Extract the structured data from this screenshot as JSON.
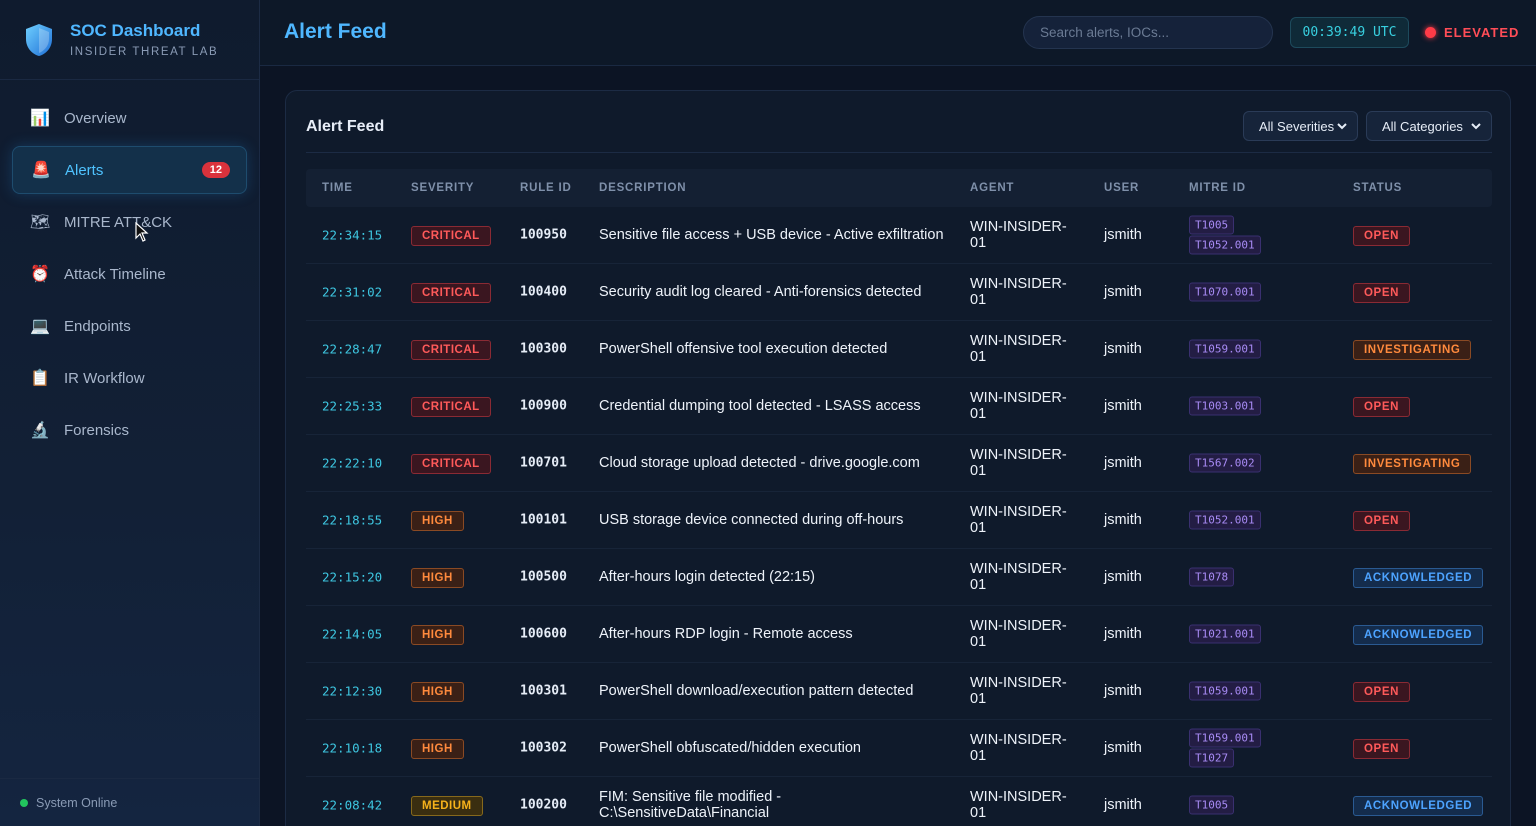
{
  "brand": {
    "title": "SOC Dashboard",
    "subtitle": "INSIDER THREAT LAB"
  },
  "nav": [
    {
      "label": "Overview",
      "icon": "bar-chart-icon",
      "glyph": "📊",
      "active": false
    },
    {
      "label": "Alerts",
      "icon": "siren-icon",
      "glyph": "🚨",
      "active": true,
      "badge": "12"
    },
    {
      "label": "MITRE ATT&CK",
      "icon": "map-icon",
      "glyph": "🗺",
      "active": false
    },
    {
      "label": "Attack Timeline",
      "icon": "clock-icon",
      "glyph": "⏰",
      "active": false
    },
    {
      "label": "Endpoints",
      "icon": "laptop-icon",
      "glyph": "💻",
      "active": false
    },
    {
      "label": "IR Workflow",
      "icon": "clipboard-icon",
      "glyph": "📋",
      "active": false
    },
    {
      "label": "Forensics",
      "icon": "microscope-icon",
      "glyph": "🔬",
      "active": false
    }
  ],
  "system_status": "System Online",
  "header": {
    "title": "Alert Feed",
    "search_placeholder": "Search alerts, IOCs...",
    "clock": "00:39:49 UTC",
    "threat_level": "ELEVATED"
  },
  "panel": {
    "title": "Alert Feed",
    "severity_filter": "All Severities",
    "category_filter": "All Categories"
  },
  "columns": {
    "time": "TIME",
    "severity": "SEVERITY",
    "rule": "RULE ID",
    "description": "DESCRIPTION",
    "agent": "AGENT",
    "user": "USER",
    "mitre": "MITRE ID",
    "status": "STATUS"
  },
  "alerts": [
    {
      "time": "22:34:15",
      "severity": "CRITICAL",
      "rule": "100950",
      "description": "Sensitive file access + USB device - Active exfiltration",
      "agent": "WIN-INSIDER-01",
      "user": "jsmith",
      "mitre": [
        "T1005",
        "T1052.001"
      ],
      "status": "OPEN"
    },
    {
      "time": "22:31:02",
      "severity": "CRITICAL",
      "rule": "100400",
      "description": "Security audit log cleared - Anti-forensics detected",
      "agent": "WIN-INSIDER-01",
      "user": "jsmith",
      "mitre": [
        "T1070.001"
      ],
      "status": "OPEN"
    },
    {
      "time": "22:28:47",
      "severity": "CRITICAL",
      "rule": "100300",
      "description": "PowerShell offensive tool execution detected",
      "agent": "WIN-INSIDER-01",
      "user": "jsmith",
      "mitre": [
        "T1059.001"
      ],
      "status": "INVESTIGATING"
    },
    {
      "time": "22:25:33",
      "severity": "CRITICAL",
      "rule": "100900",
      "description": "Credential dumping tool detected - LSASS access",
      "agent": "WIN-INSIDER-01",
      "user": "jsmith",
      "mitre": [
        "T1003.001"
      ],
      "status": "OPEN"
    },
    {
      "time": "22:22:10",
      "severity": "CRITICAL",
      "rule": "100701",
      "description": "Cloud storage upload detected - drive.google.com",
      "agent": "WIN-INSIDER-01",
      "user": "jsmith",
      "mitre": [
        "T1567.002"
      ],
      "status": "INVESTIGATING"
    },
    {
      "time": "22:18:55",
      "severity": "HIGH",
      "rule": "100101",
      "description": "USB storage device connected during off-hours",
      "agent": "WIN-INSIDER-01",
      "user": "jsmith",
      "mitre": [
        "T1052.001"
      ],
      "status": "OPEN"
    },
    {
      "time": "22:15:20",
      "severity": "HIGH",
      "rule": "100500",
      "description": "After-hours login detected (22:15)",
      "agent": "WIN-INSIDER-01",
      "user": "jsmith",
      "mitre": [
        "T1078"
      ],
      "status": "ACKNOWLEDGED"
    },
    {
      "time": "22:14:05",
      "severity": "HIGH",
      "rule": "100600",
      "description": "After-hours RDP login - Remote access",
      "agent": "WIN-INSIDER-01",
      "user": "jsmith",
      "mitre": [
        "T1021.001"
      ],
      "status": "ACKNOWLEDGED"
    },
    {
      "time": "22:12:30",
      "severity": "HIGH",
      "rule": "100301",
      "description": "PowerShell download/execution pattern detected",
      "agent": "WIN-INSIDER-01",
      "user": "jsmith",
      "mitre": [
        "T1059.001"
      ],
      "status": "OPEN"
    },
    {
      "time": "22:10:18",
      "severity": "HIGH",
      "rule": "100302",
      "description": "PowerShell obfuscated/hidden execution",
      "agent": "WIN-INSIDER-01",
      "user": "jsmith",
      "mitre": [
        "T1059.001",
        "T1027"
      ],
      "status": "OPEN"
    },
    {
      "time": "22:08:42",
      "severity": "MEDIUM",
      "rule": "100200",
      "description": "FIM: Sensitive file modified - C:\\SensitiveData\\Financial",
      "agent": "WIN-INSIDER-01",
      "user": "jsmith",
      "mitre": [
        "T1005"
      ],
      "status": "ACKNOWLEDGED"
    }
  ]
}
